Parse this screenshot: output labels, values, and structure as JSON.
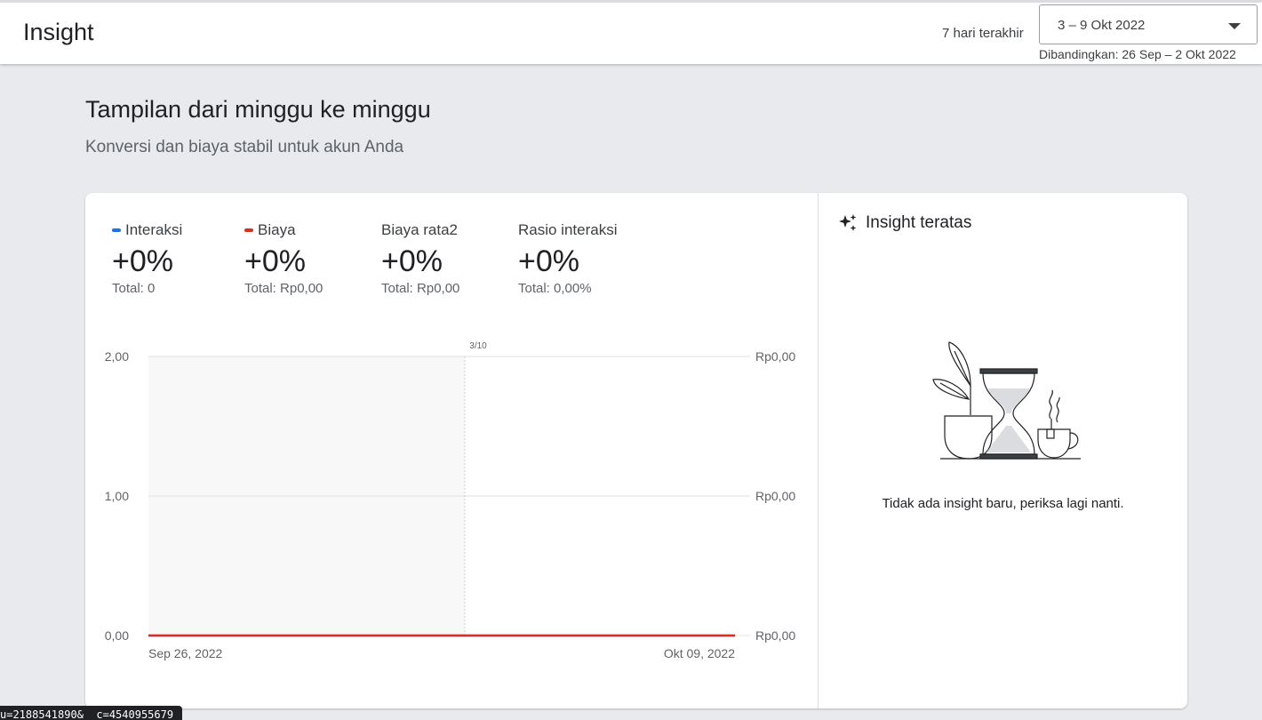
{
  "header": {
    "title": "Insight",
    "range_label": "7 hari terakhir",
    "date_range": "3 – 9 Okt 2022",
    "compare_text": "Dibandingkan: 26 Sep – 2 Okt 2022"
  },
  "section": {
    "heading": "Tampilan dari minggu ke minggu",
    "subheading": "Konversi dan biaya stabil untuk akun Anda"
  },
  "metrics": [
    {
      "label": "Interaksi",
      "change": "+0%",
      "total": "Total: 0",
      "color": "#1a73e8"
    },
    {
      "label": "Biaya",
      "change": "+0%",
      "total": "Total: Rp0,00",
      "color": "#d93025"
    },
    {
      "label": "Biaya rata2",
      "change": "+0%",
      "total": "Total: Rp0,00"
    },
    {
      "label": "Rasio interaksi",
      "change": "+0%",
      "total": "Total: 0,00%"
    }
  ],
  "chart_data": {
    "type": "line",
    "x": [
      "Sep 26, 2022",
      "Okt 09, 2022"
    ],
    "x_start_label": "Sep 26, 2022",
    "x_end_label": "Okt 09, 2022",
    "marker_label": "3/10",
    "left_ticks": [
      "2,00",
      "1,00",
      "0,00"
    ],
    "right_ticks": [
      "Rp0,00",
      "Rp0,00",
      "Rp0,00"
    ],
    "ylim": [
      0,
      2
    ],
    "series": [
      {
        "name": "Interaksi",
        "values": [
          0,
          0
        ],
        "color": "#1a73e8"
      },
      {
        "name": "Biaya",
        "values": [
          0,
          0
        ],
        "color": "#d93025"
      }
    ],
    "grid": true
  },
  "insight": {
    "title": "Insight teratas",
    "icon": "sparkle-icon",
    "empty_message": "Tidak ada insight baru, periksa lagi nanti."
  },
  "status_url": "u=2188541890&__c=4540955679"
}
